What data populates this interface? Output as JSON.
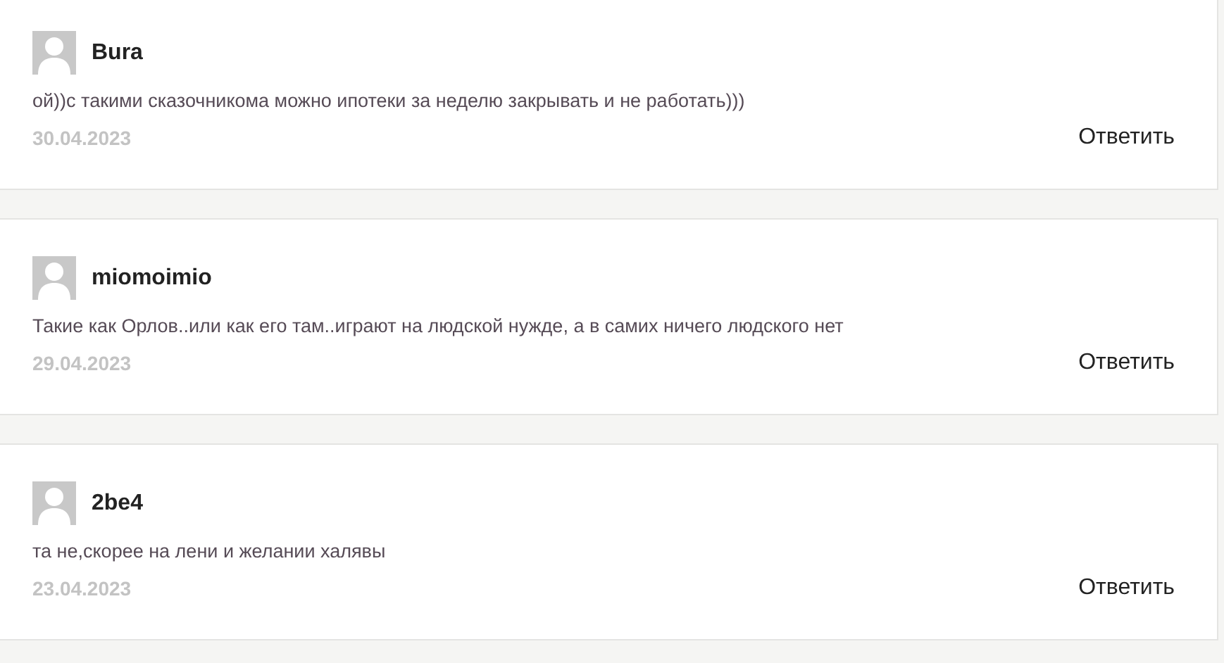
{
  "comments": [
    {
      "author": "Bura",
      "text": "ой))с такими сказочникома можно ипотеки за неделю закрывать и не работать)))",
      "date": "30.04.2023",
      "reply": "Ответить"
    },
    {
      "author": "miomoimio",
      "text": "Такие как Орлов..или как его там..играют на людской нужде, а в самих ничего людского нет",
      "date": "29.04.2023",
      "reply": "Ответить"
    },
    {
      "author": "2be4",
      "text": "та не,скорее на лени и желании халявы",
      "date": "23.04.2023",
      "reply": "Ответить"
    }
  ]
}
